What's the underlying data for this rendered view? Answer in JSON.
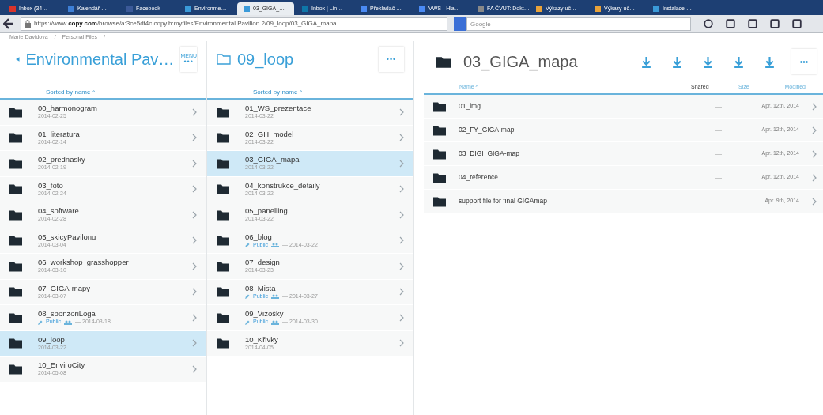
{
  "browser": {
    "tabs": [
      {
        "label": "Inbox (34…",
        "selected": false,
        "color": "#d9342b"
      },
      {
        "label": "Kalendář …",
        "selected": false,
        "color": "#3d7fd6"
      },
      {
        "label": "Facebook",
        "selected": false,
        "color": "#3b5998"
      },
      {
        "label": "Environme…",
        "selected": false,
        "color": "#3a9ad9"
      },
      {
        "label": "03_GIGA_…",
        "selected": true,
        "color": "#3a9ad9"
      },
      {
        "label": "Inbox | Lin…",
        "selected": false,
        "color": "#0e76a8"
      },
      {
        "label": "Překladač …",
        "selected": false,
        "color": "#4a8af4"
      },
      {
        "label": "VWS - Hla…",
        "selected": false,
        "color": "#4a8af4"
      },
      {
        "label": "FA ČVUT: Dokt…",
        "selected": false,
        "color": "#888888"
      },
      {
        "label": "Výkazy uč…",
        "selected": false,
        "color": "#e8a23a"
      },
      {
        "label": "Výkazy uč…",
        "selected": false,
        "color": "#e8a23a"
      },
      {
        "label": "Instalace …",
        "selected": false,
        "color": "#3a9ad9"
      }
    ],
    "url_prefix": "https://www.",
    "url_domain": "copy.com",
    "url_rest": "/browse/a:3ce5df4c:copy.b:myfiles/Environmental Pavilion 2/09_loop/03_GIGA_mapa",
    "search_placeholder": "Google"
  },
  "breadcrumb": [
    {
      "label": "Marie Davidova",
      "separator": "/"
    },
    {
      "label": "Personal Files",
      "separator": "/"
    }
  ],
  "columns": [
    {
      "title": "Environmental Pav…",
      "kind": "parent",
      "menu_label": "MENU",
      "more": "•••",
      "sort_label": "Sorted by name ^",
      "rows": [
        {
          "name": "00_harmonogram",
          "date": "2014-02-25",
          "public": false,
          "selected": false
        },
        {
          "name": "01_literatura",
          "date": "2014-02-14",
          "public": false,
          "selected": false
        },
        {
          "name": "02_prednasky",
          "date": "2014-02-19",
          "public": false,
          "selected": false
        },
        {
          "name": "03_foto",
          "date": "2014-02-24",
          "public": false,
          "selected": false
        },
        {
          "name": "04_software",
          "date": "2014-02-28",
          "public": false,
          "selected": false
        },
        {
          "name": "05_skicyPavilonu",
          "date": "2014-03-04",
          "public": false,
          "selected": false
        },
        {
          "name": "06_workshop_grasshopper",
          "date": "2014-03-10",
          "public": false,
          "selected": false
        },
        {
          "name": "07_GIGA-mapy",
          "date": "2014-03-07",
          "public": false,
          "selected": false
        },
        {
          "name": "08_sponzoriLoga",
          "date": "— 2014-03-18",
          "public": true,
          "public_label": "Public",
          "selected": false
        },
        {
          "name": "09_loop",
          "date": "2014-03-22",
          "public": false,
          "selected": true
        },
        {
          "name": "10_EnviroCity",
          "date": "2014-05-08",
          "public": false,
          "selected": false
        }
      ]
    },
    {
      "title": "09_loop",
      "kind": "folder",
      "more": "•••",
      "sort_label": "Sorted by name ^",
      "rows": [
        {
          "name": "01_WS_prezentace",
          "date": "2014-03-22",
          "public": false,
          "selected": false
        },
        {
          "name": "02_GH_model",
          "date": "2014-03-22",
          "public": false,
          "selected": false
        },
        {
          "name": "03_GIGA_mapa",
          "date": "2014-03-22",
          "public": false,
          "selected": true
        },
        {
          "name": "04_konstrukce_detaily",
          "date": "2014-03-22",
          "public": false,
          "selected": false
        },
        {
          "name": "05_panelling",
          "date": "2014-03-22",
          "public": false,
          "selected": false
        },
        {
          "name": "06_blog",
          "date": "— 2014-03-22",
          "public": true,
          "public_label": "Public",
          "selected": false
        },
        {
          "name": "07_design",
          "date": "2014-03-23",
          "public": false,
          "selected": false
        },
        {
          "name": "08_Mista",
          "date": "— 2014-03-27",
          "public": true,
          "public_label": "Public",
          "selected": false
        },
        {
          "name": "09_Vizošky",
          "date": "— 2014-03-30",
          "public": true,
          "public_label": "Public",
          "selected": false
        },
        {
          "name": "10_Křivky",
          "date": "2014-04-05",
          "public": false,
          "selected": false
        }
      ]
    }
  ],
  "detail": {
    "title": "03_GIGA_mapa",
    "more": "•••",
    "headers": {
      "name": "Name ^",
      "shared": "Shared",
      "size": "Size",
      "modified": "Modified"
    },
    "rows": [
      {
        "name": "01_img",
        "size": "—",
        "modified": "Apr. 12th, 2014"
      },
      {
        "name": "02_FY_GIGA-map",
        "size": "—",
        "modified": "Apr. 12th, 2014"
      },
      {
        "name": "03_DIGI_GIGA-map",
        "size": "—",
        "modified": "Apr. 12th, 2014"
      },
      {
        "name": "04_reference",
        "size": "—",
        "modified": "Apr. 12th, 2014"
      },
      {
        "name": "support file for final GIGAmap",
        "size": "—",
        "modified": "Apr. 9th, 2014"
      }
    ]
  }
}
